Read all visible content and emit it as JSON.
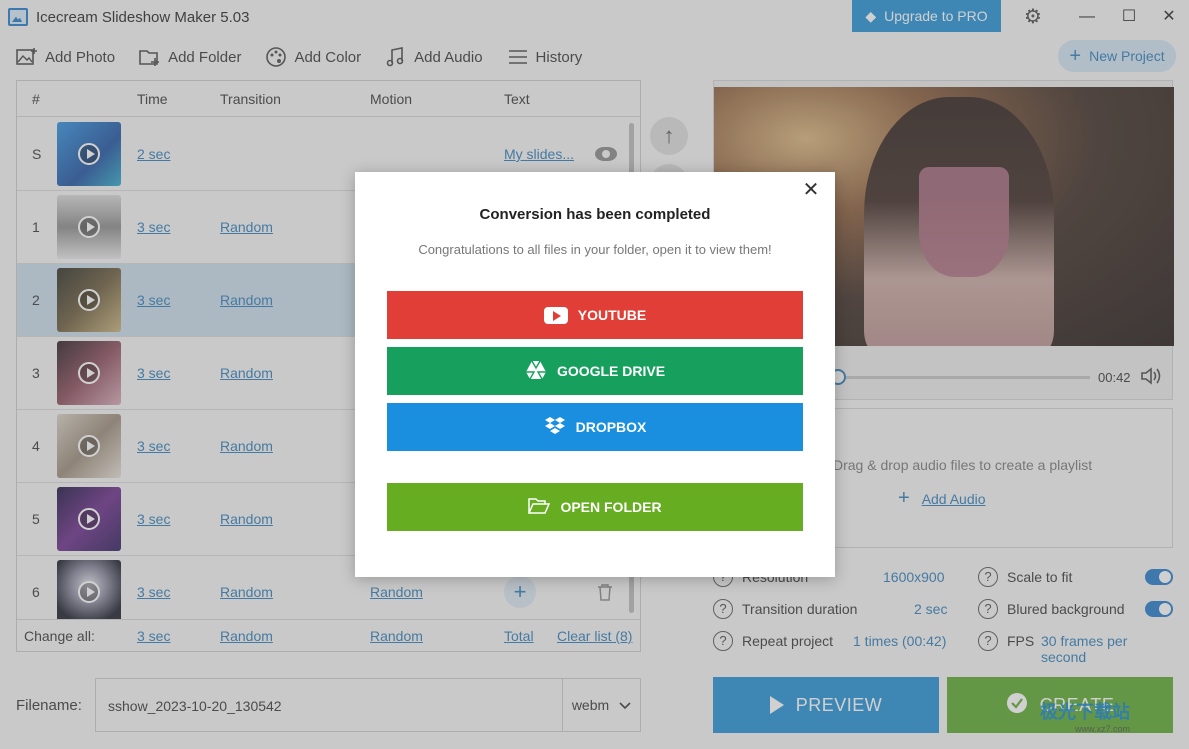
{
  "window": {
    "title": "Icecream Slideshow Maker 5.03",
    "upgrade_label": "Upgrade to PRO",
    "minimize": "—",
    "maximize": "☐",
    "close": "✕"
  },
  "toolbar": {
    "add_photo": "Add Photo",
    "add_folder": "Add Folder",
    "add_color": "Add Color",
    "add_audio": "Add Audio",
    "history": "History",
    "new_project": "New Project"
  },
  "table": {
    "headers": {
      "num": "#",
      "time": "Time",
      "transition": "Transition",
      "motion": "Motion",
      "text": "Text"
    },
    "rows": [
      {
        "num": "S",
        "time": "2 sec",
        "transition": "",
        "motion": "",
        "text": "My slides...",
        "thumb_color": "#1f6bb5"
      },
      {
        "num": "1",
        "time": "3 sec",
        "transition": "Random",
        "motion": "",
        "text": "",
        "thumb_color": "#c9c9c9"
      },
      {
        "num": "2",
        "time": "3 sec",
        "transition": "Random",
        "motion": "",
        "text": "",
        "thumb_color": "#4a4438"
      },
      {
        "num": "3",
        "time": "3 sec",
        "transition": "Random",
        "motion": "",
        "text": "",
        "thumb_color": "#3a2a30"
      },
      {
        "num": "4",
        "time": "3 sec",
        "transition": "Random",
        "motion": "",
        "text": "",
        "thumb_color": "#b8ada0"
      },
      {
        "num": "5",
        "time": "3 sec",
        "transition": "Random",
        "motion": "",
        "text": "",
        "thumb_color": "#3a1e48"
      },
      {
        "num": "6",
        "time": "3 sec",
        "transition": "Random",
        "motion": "Random",
        "text": "",
        "thumb_color": "#2a2a38"
      }
    ],
    "change_all": {
      "label": "Change all:",
      "time": "3 sec",
      "transition": "Random",
      "motion": "Random",
      "total": "Total",
      "clear": "Clear list (8)"
    }
  },
  "filename": {
    "label": "Filename:",
    "value": "sshow_2023-10-20_130542",
    "format": "webm"
  },
  "player": {
    "time": "00:42"
  },
  "audio": {
    "hint": "Drag & drop audio files to create a playlist",
    "add_label": "Add Audio"
  },
  "settings": {
    "resolution_label": "Resolution",
    "resolution_value": "1600x900",
    "scale_label": "Scale to fit",
    "transition_label": "Transition duration",
    "transition_value": "2 sec",
    "blur_label": "Blured background",
    "repeat_label": "Repeat project",
    "repeat_value": "1 times (00:42)",
    "fps_label": "FPS",
    "fps_value": "30 frames per second"
  },
  "actions": {
    "preview": "PREVIEW",
    "create": "CREATE"
  },
  "dialog": {
    "title": "Conversion has been completed",
    "subtitle": "Congratulations to all files in your folder, open it to view them!",
    "youtube": "YOUTUBE",
    "google_drive": "GOOGLE DRIVE",
    "dropbox": "DROPBOX",
    "open_folder": "OPEN FOLDER"
  },
  "watermark": {
    "text": "极光下载站",
    "sub": "www.xz7.com"
  },
  "colors": {
    "accent": "#1f8fd6",
    "link": "#2b7bb9",
    "youtube": "#e03e36",
    "gdrive": "#17a05d",
    "dropbox": "#1a8fe0",
    "open_folder": "#66ad22",
    "create": "#5aa82a"
  }
}
